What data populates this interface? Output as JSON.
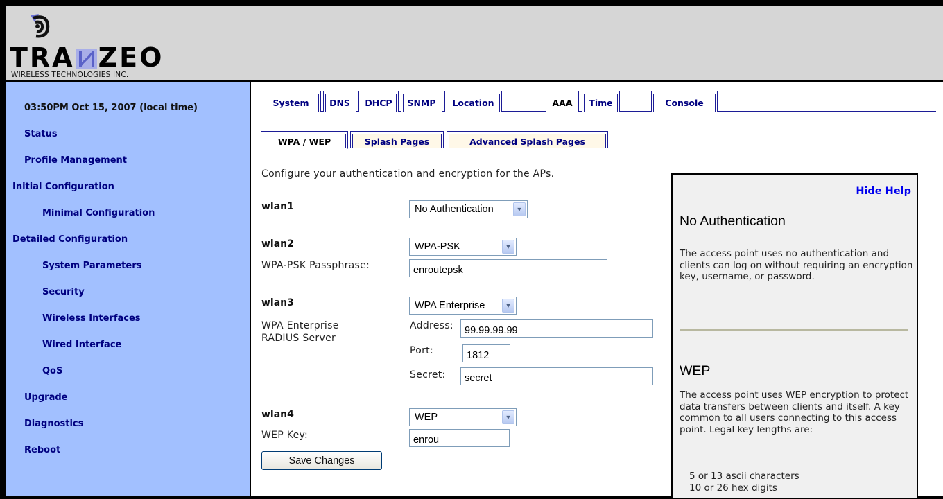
{
  "brand": {
    "name_pre": "TRA",
    "name_post": "ZEO",
    "subtitle": "WIRELESS TECHNOLOGIES INC."
  },
  "sidebar": {
    "time": "03:50PM Oct 15, 2007 (local time)",
    "items": [
      {
        "label": "Status"
      },
      {
        "label": "Profile Management"
      },
      {
        "label": "Initial Configuration"
      },
      {
        "label": "Minimal Configuration"
      },
      {
        "label": "Detailed Configuration"
      },
      {
        "label": "System Parameters"
      },
      {
        "label": "Security"
      },
      {
        "label": "Wireless Interfaces"
      },
      {
        "label": "Wired Interface"
      },
      {
        "label": "QoS"
      },
      {
        "label": "Upgrade"
      },
      {
        "label": "Diagnostics"
      },
      {
        "label": "Reboot"
      }
    ]
  },
  "tabs": {
    "items": [
      "System",
      "DNS",
      "DHCP",
      "SNMP",
      "Location",
      "AAA",
      "Time",
      "Console"
    ],
    "active": "AAA"
  },
  "subtabs": {
    "items": [
      "WPA / WEP",
      "Splash Pages",
      "Advanced Splash Pages"
    ],
    "active": "WPA / WEP"
  },
  "form": {
    "intro": "Configure your authentication and encryption for the APs.",
    "wlan1": {
      "label": "wlan1",
      "auth": "No Authentication"
    },
    "wlan2": {
      "label": "wlan2",
      "auth": "WPA-PSK",
      "passphrase_label": "WPA-PSK Passphrase:",
      "passphrase": "enroutepsk"
    },
    "wlan3": {
      "label": "wlan3",
      "auth": "WPA Enterprise",
      "radius_label_1": "WPA Enterprise",
      "radius_label_2": "RADIUS Server",
      "address_label": "Address:",
      "address": "99.99.99.99",
      "port_label": "Port:",
      "port": "1812",
      "secret_label": "Secret:",
      "secret": "secret"
    },
    "wlan4": {
      "label": "wlan4",
      "auth": "WEP",
      "key_label": "WEP Key:",
      "key": "enrou"
    },
    "save_label": "Save Changes"
  },
  "help": {
    "hide_label": "Hide Help",
    "section1_title": "No Authentication",
    "section1_text": "The access point uses no authentication and clients can log on without requiring an encryption key, username, or password.",
    "section2_title": "WEP",
    "section2_text": "The access point uses WEP encryption to protect data transfers between clients and itself. A key common to all users connecting to this access point. Legal key lengths are:",
    "key_lengths": [
      "5 or 13 ascii characters",
      "10 or 26 hex digits"
    ]
  },
  "colors": {
    "sidebar_bg": "#a2c0ff",
    "nav_text": "#000080",
    "header_bg": "#d6d6d6",
    "link": "#0000ee"
  }
}
